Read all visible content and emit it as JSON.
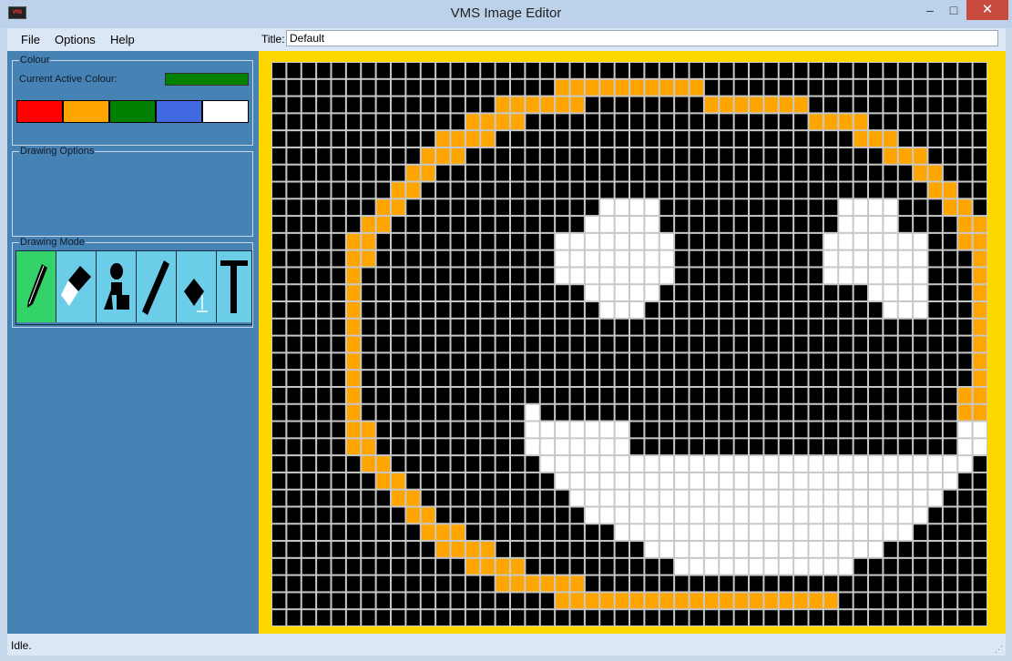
{
  "window": {
    "title": "VMS Image Editor",
    "icon_label": "VMS",
    "controls": {
      "minimize": "–",
      "maximize": "□",
      "close": "✕"
    }
  },
  "menu": {
    "file": "File",
    "options": "Options",
    "help": "Help"
  },
  "title_field": {
    "label": "Title:",
    "value": "Default"
  },
  "sidebar": {
    "colour_group": "Colour",
    "current_active_label": "Current Active Colour:",
    "active_colour": "#008000",
    "palette": [
      "#ff0000",
      "#ffa500",
      "#008000",
      "#4169e1",
      "#ffffff"
    ],
    "drawing_options_group": "Drawing Options",
    "drawing_mode_group": "Drawing Mode",
    "tools": [
      "pencil-icon",
      "eraser-icon",
      "shapes-icon",
      "line-icon",
      "fill-icon",
      "text-icon"
    ],
    "active_tool": "pencil-icon"
  },
  "canvas": {
    "background": "#ffd700",
    "pixel_grid": [
      "000000000000000000000000000000000000000000000000",
      "000000000000000000011111111110000000000000000000",
      "000000000000000111111000000001111111000000000000",
      "000000000000011110000000000000000000111100000000",
      "000000000001111000000000000000000000000111000000",
      "000000000011100000000000000000000000000001110000",
      "000000000110000000000000000000000000000000011000",
      "000000001100000000000000000000000000000000001100",
      "000000011000000000000022220000000000002222000110",
      "000000110000000000000222220000000000002222000011",
      "000001100000000000022222222000000000022222220011",
      "000001100000000000022222222000000000022222220001",
      "000001000000000000022222222000000000022222220001",
      "000001000000000000000222220000000000000022220001",
      "000001000000000000000022200000000000000002220001",
      "000001000000000000000000000000000000000000000001",
      "000001000000000000000000000000000000000000000001",
      "000001000000000000000000000000000000000000000001",
      "000001000000000000000000000000000000000000000001",
      "000001000000000000000000000000000000000000000011",
      "000001000000000002000000000000000000000000000011",
      "000001100000000002222222000000000000000000000022",
      "000001100000000002222222000000000000000000000022",
      "000000110000000000222222222222222222222222222220",
      "000000011000000000022222222222222222222222222200",
      "000000001100000000002222222222222222222222222000",
      "000000000110000000000222222222222222222222220000",
      "000000000011100000000002222222222222222222200000",
      "000000000001111000000000022222222222222220000000",
      "000000000000011110000000000222222222222000000000",
      "000000000000000111111000000000000000000000000000",
      "000000000000000000011111111111111111110000000000",
      "000000000000000000000000000000000000000000000000"
    ],
    "colour_key": {
      "0": "#000000",
      "1": "#ffa500",
      "2": "#ffffff"
    }
  },
  "status": {
    "text": "Idle."
  }
}
